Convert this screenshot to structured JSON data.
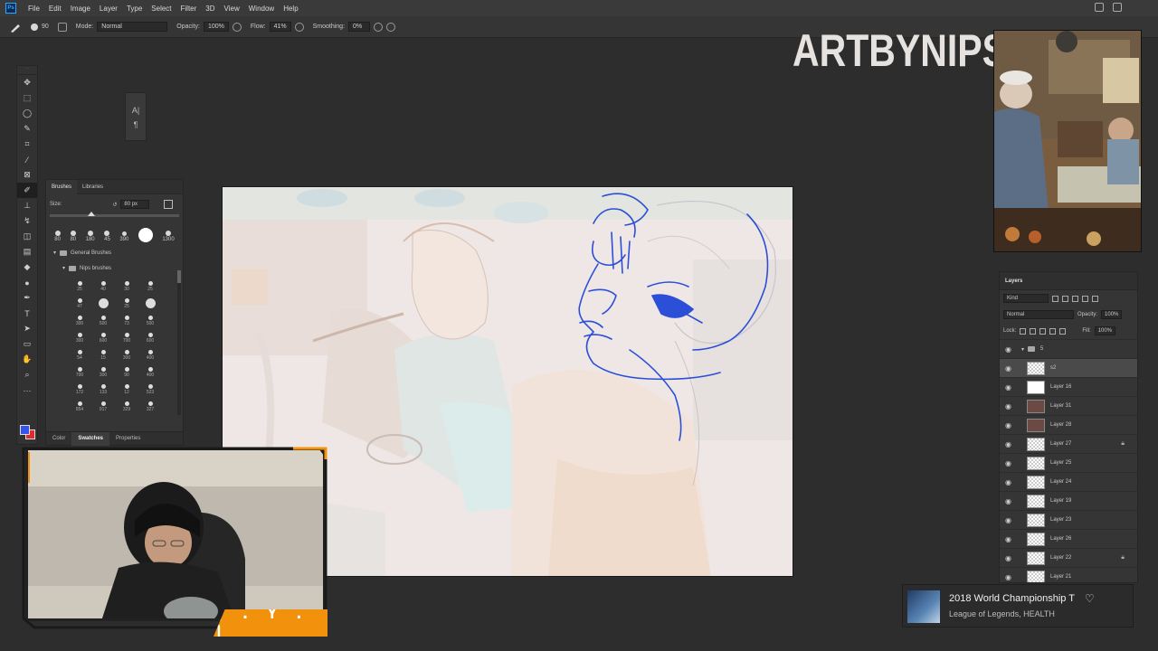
{
  "menu": [
    "File",
    "Edit",
    "Image",
    "Layer",
    "Type",
    "Select",
    "Filter",
    "3D",
    "View",
    "Window",
    "Help"
  ],
  "options": {
    "brush_size": "90",
    "mode_label": "Mode:",
    "mode_value": "Normal",
    "opacity_label": "Opacity:",
    "opacity_value": "100%",
    "flow_label": "Flow:",
    "flow_value": "41%",
    "smoothing_label": "Smoothing:",
    "smoothing_value": "0%"
  },
  "char_panel": {
    "a": "A|",
    "b": "¶"
  },
  "brushes": {
    "tab_active": "Brushes",
    "tab_other": "Libraries",
    "size_label": "Size:",
    "size_value": "80 px",
    "presets": [
      "80",
      "80",
      "180",
      "45",
      "390",
      "1300"
    ],
    "folder": "General Brushes",
    "subfolder": "Nips brushes",
    "grid": [
      "25",
      "40",
      "30",
      "25",
      "47",
      "",
      "25",
      "",
      "300",
      "500",
      "73",
      "500",
      "300",
      "600",
      "700",
      "600",
      "54",
      "15",
      "300",
      "400",
      "700",
      "300",
      "90",
      "400",
      "172",
      "133",
      "12",
      "523",
      "854",
      "917",
      "329",
      "327"
    ]
  },
  "bottom_tabs": [
    "Color",
    "Swatches",
    "Properties"
  ],
  "watermark": "ARTBYNIPS",
  "layers": {
    "title": "Layers",
    "kind": "Kind",
    "blend": "Normal",
    "opacity_label": "Opacity:",
    "opacity_value": "100%",
    "lock_label": "Lock:",
    "fill_label": "Fill:",
    "fill_value": "100%",
    "group_name": "5",
    "items": [
      {
        "name": "s2",
        "thumb": "check",
        "selected": true,
        "locked": false
      },
      {
        "name": "Layer 16",
        "thumb": "white",
        "selected": false,
        "locked": false
      },
      {
        "name": "Layer 31",
        "thumb": "dark",
        "selected": false,
        "locked": false
      },
      {
        "name": "Layer 28",
        "thumb": "dark",
        "selected": false,
        "locked": false
      },
      {
        "name": "Layer 27",
        "thumb": "check",
        "selected": false,
        "locked": true
      },
      {
        "name": "Layer 25",
        "thumb": "check",
        "selected": false,
        "locked": false
      },
      {
        "name": "Layer 24",
        "thumb": "check",
        "selected": false,
        "locked": false
      },
      {
        "name": "Layer 19",
        "thumb": "check",
        "selected": false,
        "locked": false
      },
      {
        "name": "Layer 23",
        "thumb": "check",
        "selected": false,
        "locked": false
      },
      {
        "name": "Layer 26",
        "thumb": "check",
        "selected": false,
        "locked": false
      },
      {
        "name": "Layer 22",
        "thumb": "check",
        "selected": false,
        "locked": true
      },
      {
        "name": "Layer 21",
        "thumb": "check",
        "selected": false,
        "locked": false
      }
    ]
  },
  "stream_tag": "[ . Y . ]",
  "music": {
    "title": "2018 World Championship T",
    "artist": "League of Legends, HEALTH"
  },
  "colors": {
    "foreground": "#3355ee",
    "background": "#e12b2b",
    "accent": "#f2920c",
    "sketch_line": "#2c4fd8"
  }
}
